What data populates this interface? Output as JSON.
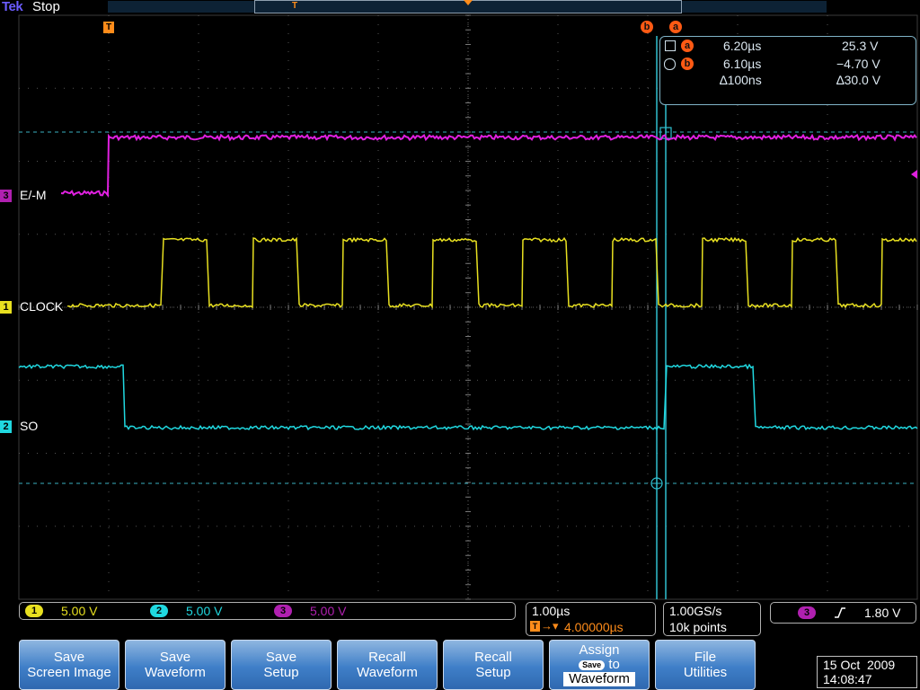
{
  "top": {
    "brand": "Tek",
    "run_state": "Stop"
  },
  "markers": {
    "trigger_point": "T",
    "cursor_b": "b",
    "cursor_a": "a"
  },
  "channels": [
    {
      "number": "3",
      "label": "E/-M",
      "color": "#e020e0"
    },
    {
      "number": "1",
      "label": "CLOCK",
      "color": "#e8e020"
    },
    {
      "number": "2",
      "label": "SO",
      "color": "#20d8e0"
    }
  ],
  "cursor_readout": {
    "a": {
      "id": "a",
      "time": "6.20µs",
      "voltage": "25.3 V"
    },
    "b": {
      "id": "b",
      "time": "6.10µs",
      "voltage": "−4.70 V"
    },
    "delta": {
      "time": "∆100ns",
      "voltage": "∆30.0 V"
    }
  },
  "vertical": [
    {
      "number": "1",
      "scale": "5.00 V",
      "color": "#e8e020"
    },
    {
      "number": "2",
      "scale": "5.00 V",
      "color": "#20d8e0"
    },
    {
      "number": "3",
      "scale": "5.00 V",
      "color": "#b020b0"
    }
  ],
  "horizontal": {
    "scale": "1.00µs",
    "trigger_position": "4.00000µs"
  },
  "acquisition": {
    "sample_rate": "1.00GS/s",
    "record_length": "10k points"
  },
  "trigger": {
    "source": "3",
    "slope": "rising",
    "level": "1.80 V"
  },
  "bezel": [
    {
      "line1": "Save",
      "line2": "Screen Image"
    },
    {
      "line1": "Save",
      "line2": "Waveform"
    },
    {
      "line1": "Save",
      "line2": "Setup"
    },
    {
      "line1": "Recall",
      "line2": "Waveform"
    },
    {
      "line1": "Recall",
      "line2": "Setup"
    },
    {
      "line1": "Assign",
      "pill": "Save",
      "pill_suffix": "to",
      "line3": "Waveform"
    },
    {
      "line1": "File",
      "line2": "Utilities"
    }
  ],
  "datetime": {
    "date": "15 Oct  2009",
    "time": "14:08:47"
  }
}
